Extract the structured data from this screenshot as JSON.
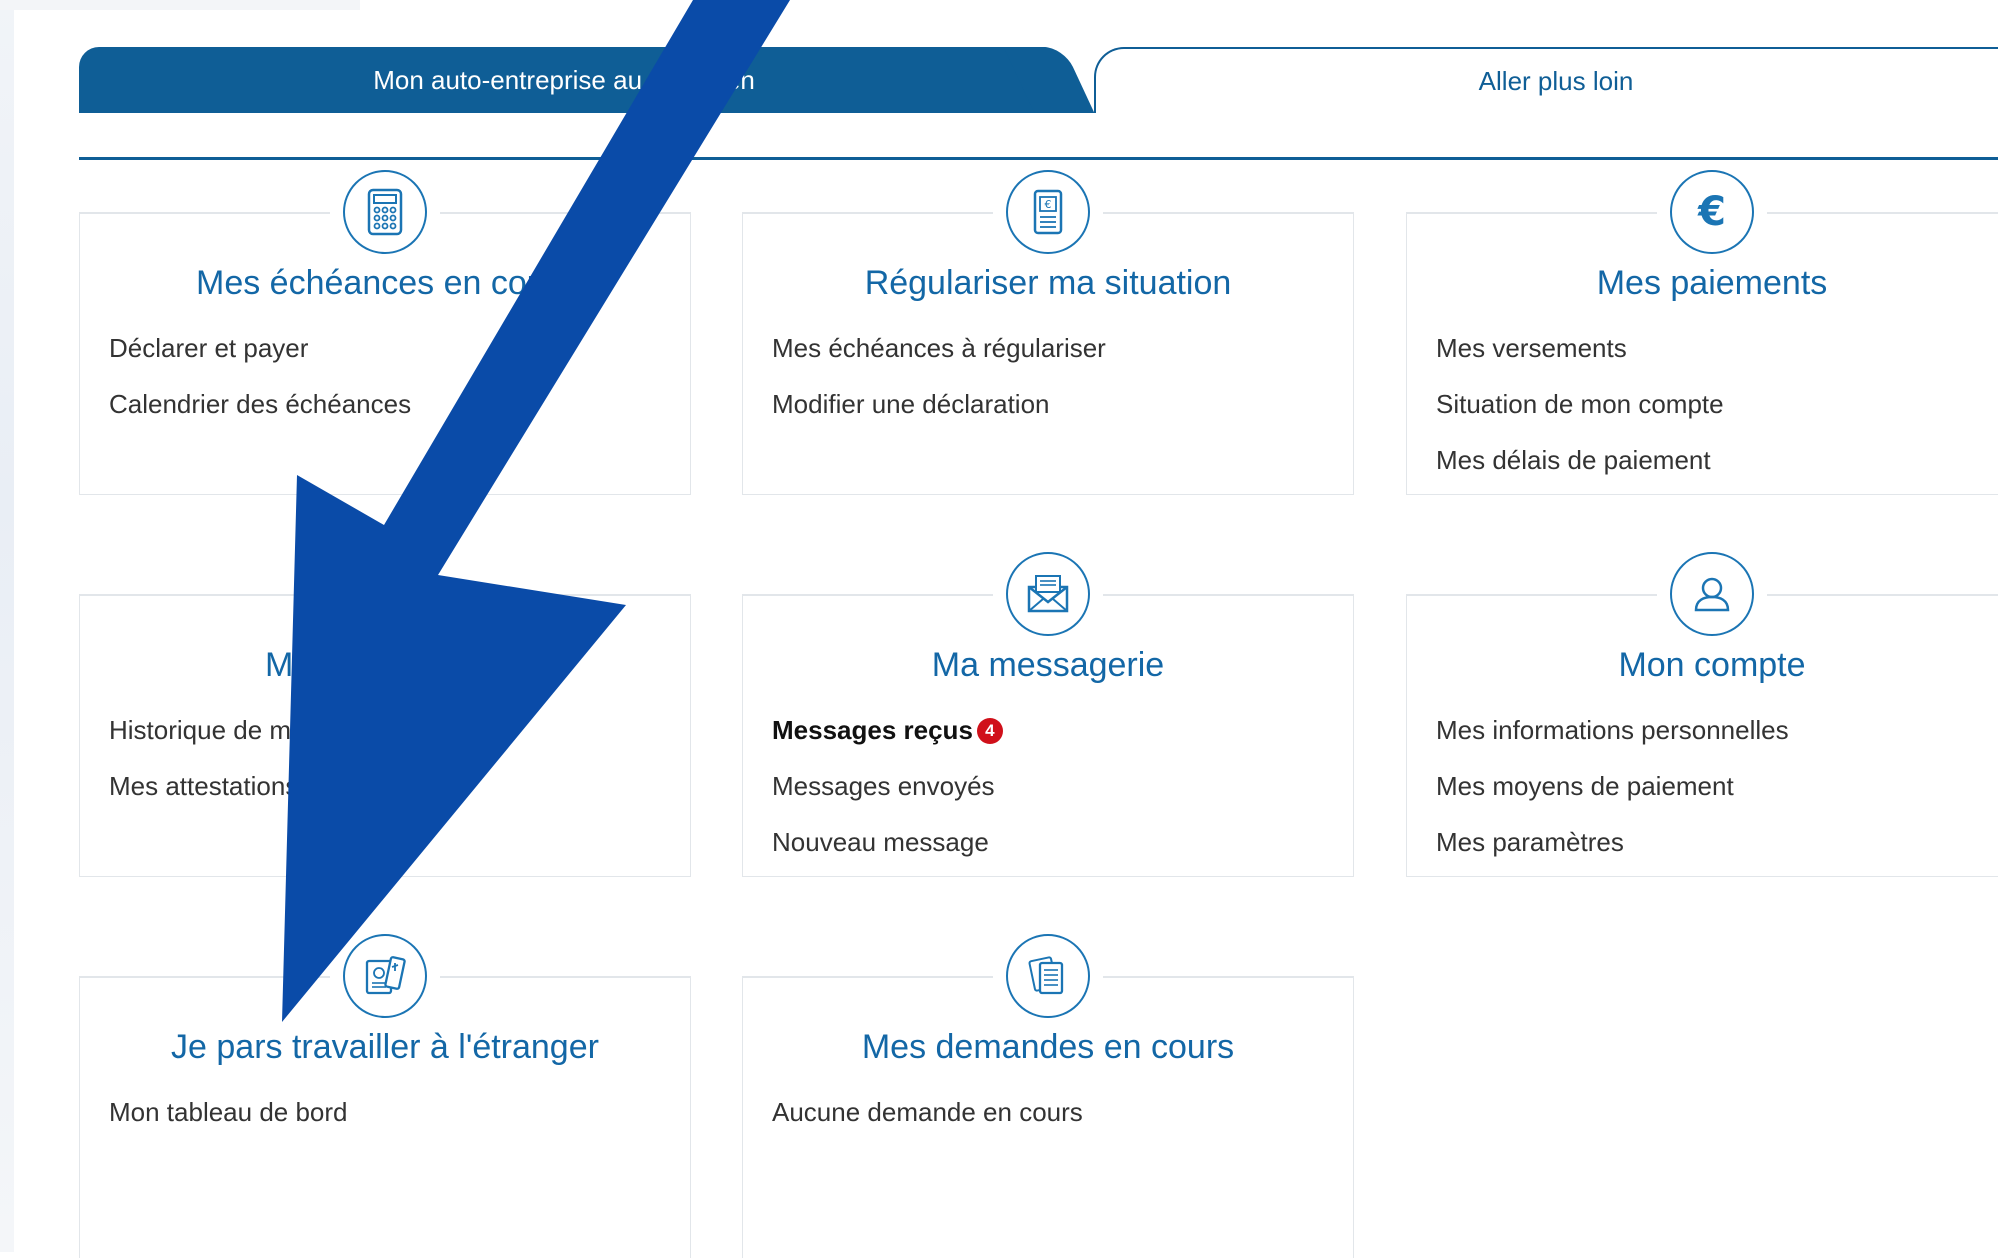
{
  "tabs": {
    "active_label": "Mon auto-entreprise au quotidien",
    "inactive_label": "Aller plus loin"
  },
  "cards": [
    {
      "title": "Mes échéances en cours",
      "icon": "calculator-icon",
      "links": [
        "Déclarer et payer",
        "Calendrier des échéances"
      ]
    },
    {
      "title": "Régulariser ma situation",
      "icon": "euro-document-icon",
      "links": [
        "Mes échéances à régulariser",
        "Modifier une déclaration"
      ]
    },
    {
      "title": "Mes paiements",
      "icon": "euro-icon",
      "links": [
        "Mes versements",
        "Situation de mon compte",
        "Mes délais de paiement"
      ]
    },
    {
      "title": "Mes documents",
      "icon": "documents-icon",
      "links": [
        "Historique de mes déclarations",
        "Mes attestations"
      ]
    },
    {
      "title": "Ma messagerie",
      "icon": "envelope-icon",
      "links": [
        "Messages reçus",
        "Messages envoyés",
        "Nouveau message"
      ],
      "unread_count": "4"
    },
    {
      "title": "Mon compte",
      "icon": "user-icon",
      "links": [
        "Mes informations personnelles",
        "Mes moyens de paiement",
        "Mes paramètres"
      ]
    },
    {
      "title": "Je pars travailler à l'étranger",
      "icon": "passport-icon",
      "links": [
        "Mon tableau de bord"
      ]
    },
    {
      "title": "Mes demandes en cours",
      "icon": "papers-icon",
      "links": [
        "Aucune demande en cours"
      ]
    }
  ],
  "colors": {
    "primary": "#0f5e96",
    "title": "#1367a6",
    "arrow": "#0a4ba8",
    "badge": "#d0101a"
  }
}
